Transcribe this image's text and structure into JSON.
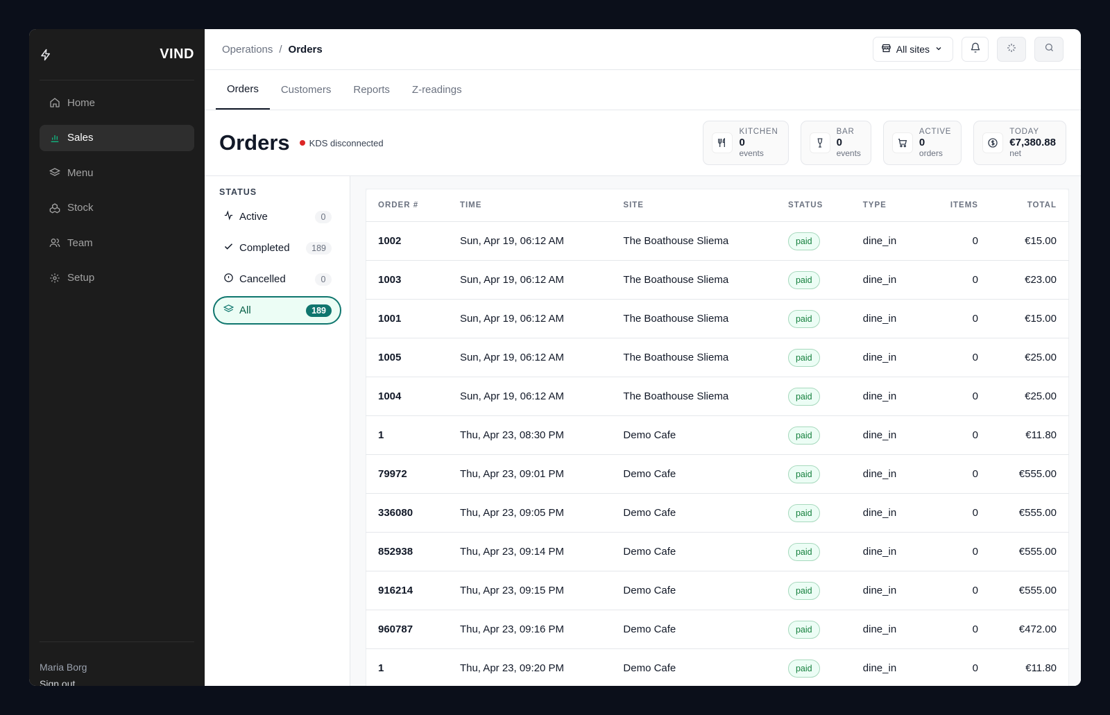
{
  "sidebar": {
    "brand": "VIND",
    "items": [
      {
        "label": "Home",
        "icon": "home-icon"
      },
      {
        "label": "Sales",
        "icon": "bar-chart-icon",
        "active": true
      },
      {
        "label": "Menu",
        "icon": "layers-icon"
      },
      {
        "label": "Stock",
        "icon": "boxes-icon"
      },
      {
        "label": "Team",
        "icon": "users-icon"
      },
      {
        "label": "Setup",
        "icon": "gear-icon"
      }
    ],
    "user": "Maria Borg",
    "signout": "Sign out"
  },
  "breadcrumb": {
    "parent": "Operations",
    "separator": "/",
    "current": "Orders"
  },
  "topbar": {
    "sites_label": "All sites"
  },
  "tabs": [
    "Orders",
    "Customers",
    "Reports",
    "Z-readings"
  ],
  "page": {
    "title": "Orders",
    "kds_status": "KDS disconnected"
  },
  "stats": [
    {
      "label": "KITCHEN",
      "value": "0",
      "sub": "events",
      "icon": "utensils-icon"
    },
    {
      "label": "BAR",
      "value": "0",
      "sub": "events",
      "icon": "wine-glass-icon"
    },
    {
      "label": "ACTIVE",
      "value": "0",
      "sub": "orders",
      "icon": "cart-icon"
    },
    {
      "label": "TODAY",
      "value": "€7,380.88",
      "sub": "net",
      "icon": "dollar-circle-icon"
    }
  ],
  "filters": {
    "title": "STATUS",
    "items": [
      {
        "label": "Active",
        "count": "0",
        "icon": "activity-icon"
      },
      {
        "label": "Completed",
        "count": "189",
        "icon": "check-icon"
      },
      {
        "label": "Cancelled",
        "count": "0",
        "icon": "alert-circle-icon"
      },
      {
        "label": "All",
        "count": "189",
        "icon": "layers-icon",
        "active": true
      }
    ]
  },
  "table": {
    "headers": [
      "ORDER #",
      "TIME",
      "SITE",
      "STATUS",
      "TYPE",
      "ITEMS",
      "TOTAL"
    ],
    "rows": [
      [
        "1002",
        "Sun, Apr 19, 06:12 AM",
        "The Boathouse Sliema",
        "paid",
        "dine_in",
        "0",
        "€15.00"
      ],
      [
        "1003",
        "Sun, Apr 19, 06:12 AM",
        "The Boathouse Sliema",
        "paid",
        "dine_in",
        "0",
        "€23.00"
      ],
      [
        "1001",
        "Sun, Apr 19, 06:12 AM",
        "The Boathouse Sliema",
        "paid",
        "dine_in",
        "0",
        "€15.00"
      ],
      [
        "1005",
        "Sun, Apr 19, 06:12 AM",
        "The Boathouse Sliema",
        "paid",
        "dine_in",
        "0",
        "€25.00"
      ],
      [
        "1004",
        "Sun, Apr 19, 06:12 AM",
        "The Boathouse Sliema",
        "paid",
        "dine_in",
        "0",
        "€25.00"
      ],
      [
        "1",
        "Thu, Apr 23, 08:30 PM",
        "Demo Cafe",
        "paid",
        "dine_in",
        "0",
        "€11.80"
      ],
      [
        "79972",
        "Thu, Apr 23, 09:01 PM",
        "Demo Cafe",
        "paid",
        "dine_in",
        "0",
        "€555.00"
      ],
      [
        "336080",
        "Thu, Apr 23, 09:05 PM",
        "Demo Cafe",
        "paid",
        "dine_in",
        "0",
        "€555.00"
      ],
      [
        "852938",
        "Thu, Apr 23, 09:14 PM",
        "Demo Cafe",
        "paid",
        "dine_in",
        "0",
        "€555.00"
      ],
      [
        "916214",
        "Thu, Apr 23, 09:15 PM",
        "Demo Cafe",
        "paid",
        "dine_in",
        "0",
        "€555.00"
      ],
      [
        "960787",
        "Thu, Apr 23, 09:16 PM",
        "Demo Cafe",
        "paid",
        "dine_in",
        "0",
        "€472.00"
      ],
      [
        "1",
        "Thu, Apr 23, 09:20 PM",
        "Demo Cafe",
        "paid",
        "dine_in",
        "0",
        "€11.80"
      ]
    ]
  },
  "colors": {
    "accent": "#0f766e",
    "paid_text": "#15803d",
    "alert": "#dc2626"
  }
}
